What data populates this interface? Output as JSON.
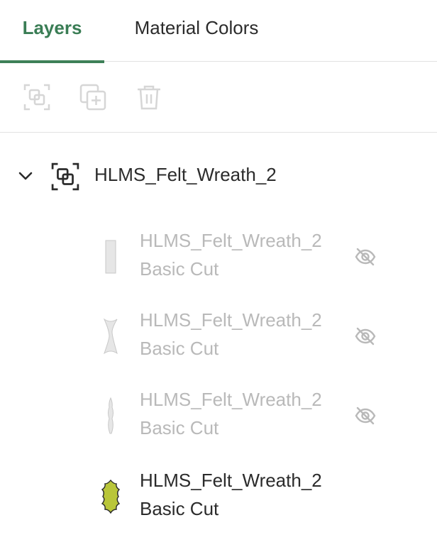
{
  "tabs": [
    {
      "label": "Layers",
      "active": true
    },
    {
      "label": "Material Colors",
      "active": false
    }
  ],
  "toolbar": {
    "buttons": [
      {
        "icon": "group-icon",
        "enabled": false
      },
      {
        "icon": "duplicate-icon",
        "enabled": false
      },
      {
        "icon": "trash-icon",
        "enabled": false
      }
    ]
  },
  "group": {
    "name": "HLMS_Felt_Wreath_2",
    "expanded": true,
    "icon": "group-icon"
  },
  "layers": [
    {
      "name": "HLMS_Felt_Wreath_2",
      "type": "Basic Cut",
      "hidden": true,
      "thumb": "rectangle-shape",
      "color": "#e6e6e6"
    },
    {
      "name": "HLMS_Felt_Wreath_2",
      "type": "Basic Cut",
      "hidden": true,
      "thumb": "bowtie-shape",
      "color": "#e6e6e6"
    },
    {
      "name": "HLMS_Felt_Wreath_2",
      "type": "Basic Cut",
      "hidden": true,
      "thumb": "stem-shape",
      "color": "#e6e6e6"
    },
    {
      "name": "HLMS_Felt_Wreath_2",
      "type": "Basic Cut",
      "hidden": false,
      "thumb": "holly-leaf-shape",
      "color": "#b9c63a"
    }
  ],
  "colors": {
    "accent": "#3a7d55",
    "hidden_text": "#b9b9b9",
    "text": "#2b2b2b",
    "disabled_icon": "#d6d6d6"
  }
}
